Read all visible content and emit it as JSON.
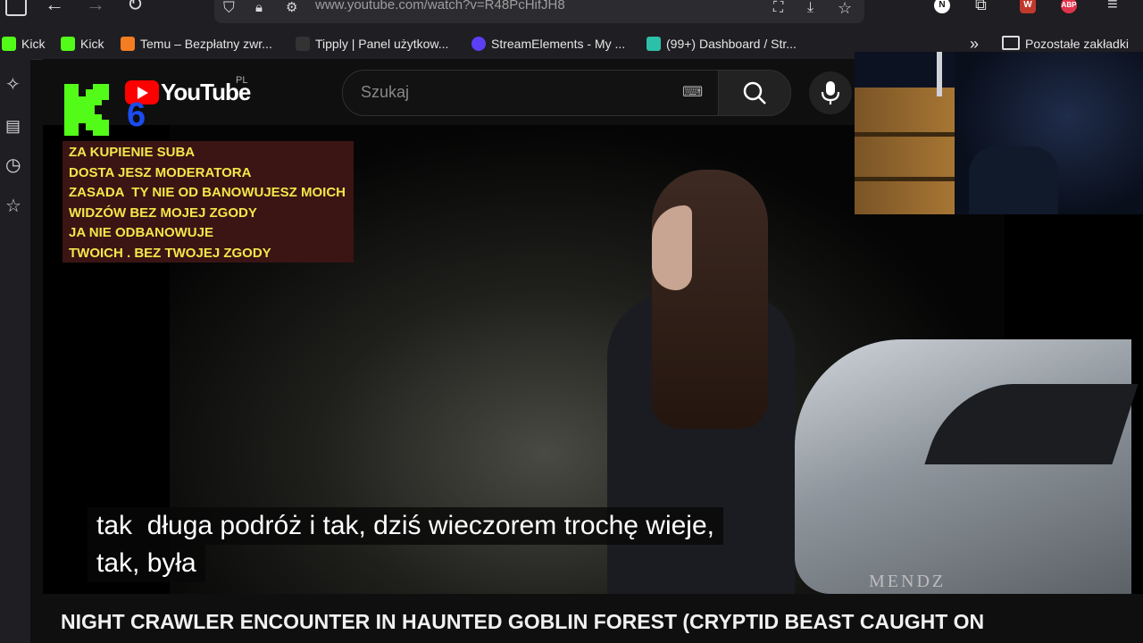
{
  "browser": {
    "url": "www.youtube.com/watch?v=R48PcHifJH8",
    "bookmarks": [
      {
        "label": "Kick",
        "color": "#53fc18"
      },
      {
        "label": "Kick",
        "color": "#53fc18"
      },
      {
        "label": "Temu – Bezpłatny zwr...",
        "color": "#f57d21"
      },
      {
        "label": "Tipply | Panel użytkow...",
        "color": "#222222"
      },
      {
        "label": "StreamElements - My ...",
        "color": "#5b3ff5"
      },
      {
        "label": "(99+) Dashboard / Str...",
        "color": "#2dc0a8"
      }
    ],
    "other_bookmarks": "Pozostałe zakładki",
    "ext_n": "N",
    "ext_abp": "ABP",
    "ext_w": "W"
  },
  "youtube": {
    "logo_text": "YouTube",
    "region": "PL",
    "search_placeholder": "Szukaj",
    "video_title": "NIGHT CRAWLER ENCOUNTER IN HAUNTED GOBLIN FOREST (CRYPTID BEAST CAUGHT ON"
  },
  "overlay": {
    "notice_lines": [
      "ZA KUPIENIE SUBA",
      "DOSTA JESZ MODERATORA",
      "ZASADA  TY NIE OD BANOWUJESZ MOICH",
      "WIDZÓW BEZ MOJEJ ZGODY",
      "JA NIE ODBANOWUJE",
      "TWOICH . BEZ TWOJEJ ZGODY"
    ],
    "kick_number": "6"
  },
  "video": {
    "subtitle_line1": "tak  długa podróż i tak, dziś wieczorem trochę wieje,",
    "subtitle_line2": "tak, była",
    "watermark": "MENDZ"
  }
}
